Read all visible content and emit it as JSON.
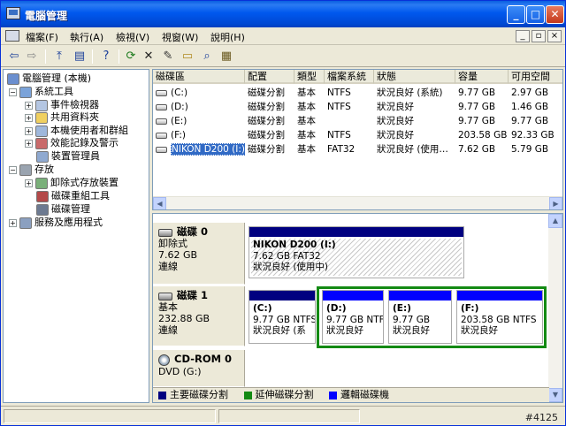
{
  "window": {
    "title": "電腦管理"
  },
  "menu": [
    {
      "label": "檔案(F)"
    },
    {
      "label": "執行(A)"
    },
    {
      "label": "檢視(V)"
    },
    {
      "label": "視窗(W)"
    },
    {
      "label": "說明(H)"
    }
  ],
  "mdi_buttons": [
    "_",
    "▫",
    "×"
  ],
  "toolbar": [
    {
      "icon": "back-icon",
      "glyph": "⇦"
    },
    {
      "icon": "forward-icon",
      "glyph": "⇨"
    },
    {
      "icon": "up-folder-icon",
      "glyph": "⤒"
    },
    {
      "icon": "show-hide-tree-icon",
      "glyph": "▤"
    },
    {
      "icon": "help-icon",
      "glyph": "?"
    },
    {
      "icon": "refresh-icon",
      "glyph": "⟳"
    },
    {
      "icon": "delete-icon",
      "glyph": "✕"
    },
    {
      "icon": "properties-icon",
      "glyph": "✎"
    },
    {
      "icon": "open-folder-icon",
      "glyph": "▭"
    },
    {
      "icon": "search-icon",
      "glyph": "⌕"
    },
    {
      "icon": "export-list-icon",
      "glyph": "▦"
    }
  ],
  "tree": [
    {
      "label": "電腦管理 (本機)",
      "expander": "",
      "icon_color": "#6b8fcf"
    },
    {
      "label": "系統工具",
      "expander": "−",
      "icon_color": "#7ba3d9"
    },
    {
      "label": "事件檢視器",
      "expander": "+",
      "icon_color": "#b4c6e2"
    },
    {
      "label": "共用資料夾",
      "expander": "+",
      "icon_color": "#f0d060"
    },
    {
      "label": "本機使用者和群組",
      "expander": "+",
      "icon_color": "#9fb8dc"
    },
    {
      "label": "效能記錄及警示",
      "expander": "+",
      "icon_color": "#c96b6b"
    },
    {
      "label": "裝置管理員",
      "expander": "",
      "icon_color": "#8fa9d0"
    },
    {
      "label": "存放",
      "expander": "−",
      "icon_color": "#9aa4b0"
    },
    {
      "label": "卸除式存放裝置",
      "expander": "+",
      "icon_color": "#7ab07a"
    },
    {
      "label": "磁碟重組工具",
      "expander": "",
      "icon_color": "#b44a4a"
    },
    {
      "label": "磁碟管理",
      "expander": "",
      "icon_color": "#6d7a91"
    },
    {
      "label": "服務及應用程式",
      "expander": "+",
      "icon_color": "#8ba0c0"
    }
  ],
  "volumes": {
    "headers": [
      "磁碟區",
      "配置",
      "類型",
      "檔案系統",
      "狀態",
      "容量",
      "可用空間"
    ],
    "rows": [
      {
        "name": "(C:)",
        "layout": "磁碟分割",
        "type": "基本",
        "fs": "NTFS",
        "status": "狀況良好 (系統)",
        "capacity": "9.77 GB",
        "free": "2.97 GB",
        "selected": false
      },
      {
        "name": "(D:)",
        "layout": "磁碟分割",
        "type": "基本",
        "fs": "NTFS",
        "status": "狀況良好",
        "capacity": "9.77 GB",
        "free": "1.46 GB",
        "selected": false
      },
      {
        "name": "(E:)",
        "layout": "磁碟分割",
        "type": "基本",
        "fs": "",
        "status": "狀況良好",
        "capacity": "9.77 GB",
        "free": "9.77 GB",
        "selected": false
      },
      {
        "name": "(F:)",
        "layout": "磁碟分割",
        "type": "基本",
        "fs": "NTFS",
        "status": "狀況良好",
        "capacity": "203.58 GB",
        "free": "92.33 GB",
        "selected": false
      },
      {
        "name": "NIKON D200 (I:)",
        "layout": "磁碟分割",
        "type": "基本",
        "fs": "FAT32",
        "status": "狀況良好 (使用…",
        "capacity": "7.62 GB",
        "free": "5.79 GB",
        "selected": true
      }
    ]
  },
  "disks": [
    {
      "name": "磁碟 0",
      "kind": "卸除式",
      "size": "7.62 GB",
      "state": "連線",
      "partitions": [
        {
          "title": "NIKON D200  (I:)",
          "line2": "7.62 GB FAT32",
          "line3": "狀況良好 (使用中)"
        }
      ]
    },
    {
      "name": "磁碟 1",
      "kind": "基本",
      "size": "232.88 GB",
      "state": "連線",
      "partitions": [
        {
          "title": "(C:)",
          "line2": "9.77 GB NTFS",
          "line3": "狀況良好 (系"
        },
        {
          "title": "(D:)",
          "line2": "9.77 GB NTF",
          "line3": "狀況良好"
        },
        {
          "title": "(E:)",
          "line2": "9.77 GB",
          "line3": "狀況良好"
        },
        {
          "title": "(F:)",
          "line2": "203.58 GB NTFS",
          "line3": "狀況良好"
        }
      ]
    },
    {
      "name": "CD-ROM 0",
      "kind": "DVD (G:)",
      "size": "",
      "state": "",
      "partitions": []
    }
  ],
  "legend": [
    {
      "label": "主要磁碟分割",
      "color": "#000080"
    },
    {
      "label": "延伸磁碟分割",
      "color": "#138a13"
    },
    {
      "label": "邏輯磁碟機",
      "color": "#0000ff"
    }
  ],
  "colors": {
    "primary_bar": "#000080",
    "logical_bar": "#0000ff",
    "extended_border": "#138a13",
    "selection": "#316ac5"
  },
  "watermark": "#4125"
}
